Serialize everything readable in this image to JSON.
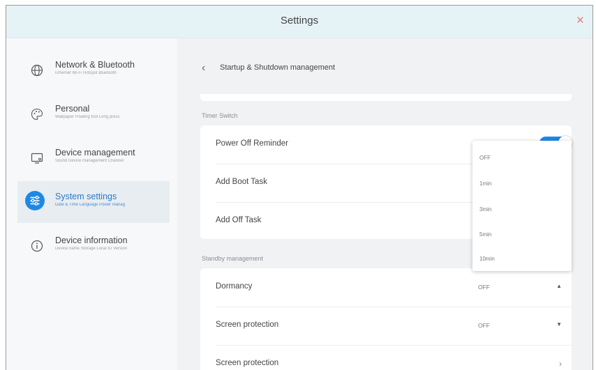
{
  "window": {
    "title": "Settings",
    "close_glyph": "×"
  },
  "sidebar": {
    "items": [
      {
        "title": "Network & Bluetooth",
        "subtitle": "Ethernet Wi-Fi Hotspot Bluetooth",
        "icon": "globe-icon",
        "active": false
      },
      {
        "title": "Personal",
        "subtitle": "Wallpaper Floating tool Long press",
        "icon": "palette-icon",
        "active": false
      },
      {
        "title": "Device management",
        "subtitle": "Sound Device management Channel",
        "icon": "monitor-icon",
        "active": false
      },
      {
        "title": "System settings",
        "subtitle": "Date & Time Language Power manag",
        "icon": "sliders-icon",
        "active": true
      },
      {
        "title": "Device information",
        "subtitle": "Device name Storage Local ID Version",
        "icon": "info-icon",
        "active": false
      }
    ]
  },
  "page": {
    "back_glyph": "‹",
    "title": "Startup & Shutdown management"
  },
  "timer_switch": {
    "label": "Timer Switch",
    "rows": [
      {
        "label": "Power Off Reminder",
        "toggle_on": true
      },
      {
        "label": "Add Boot Task"
      },
      {
        "label": "Add Off Task"
      }
    ]
  },
  "standby": {
    "label": "Standby management",
    "rows": [
      {
        "label": "Dormancy",
        "value": "OFF",
        "caret": "▲"
      },
      {
        "label": "Screen protection",
        "value": "OFF",
        "caret": "▼"
      },
      {
        "label": "Screen protection",
        "chevron": "›"
      }
    ]
  },
  "dropdown": {
    "options": [
      "OFF",
      "1min",
      "3min",
      "5min",
      "10min"
    ]
  },
  "colors": {
    "accent": "#1e88e5",
    "titlebar": "#e6f3f6",
    "close": "#e07a7a"
  }
}
